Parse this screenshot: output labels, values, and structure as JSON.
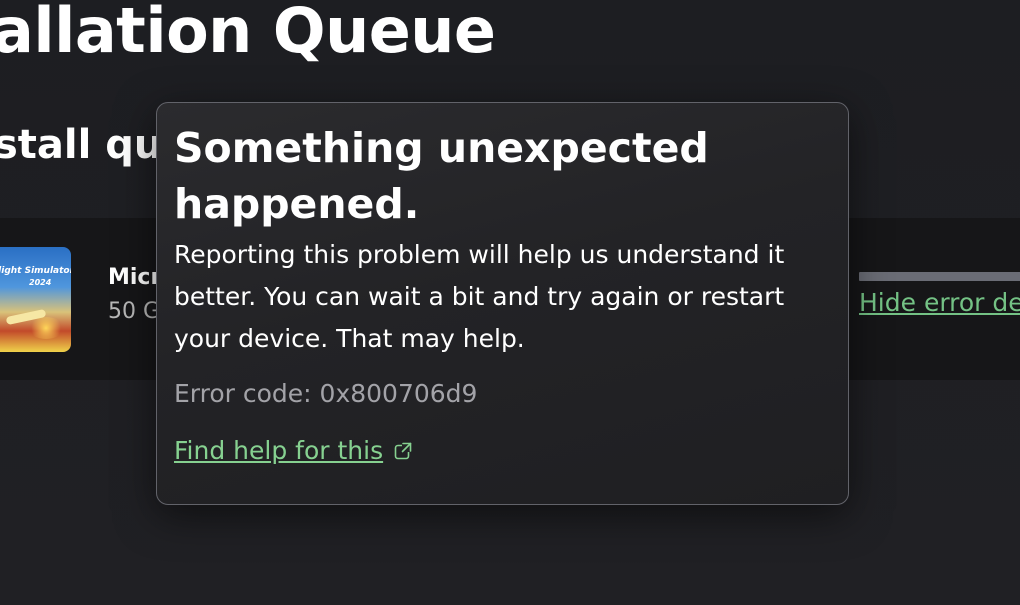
{
  "page": {
    "title": "allation Queue",
    "section_title": "stall que"
  },
  "queue_item": {
    "thumbnail_line1": "Flight Simulator",
    "thumbnail_line2": "2024",
    "name": "Micr",
    "size": "50 G",
    "hide_error_link": "Hide error de"
  },
  "dialog": {
    "title": "Something unexpected happened.",
    "body": "Reporting this problem will help us understand it better. You can wait a bit and try again or restart your device. That may help.",
    "error_code": "Error code: 0x800706d9",
    "help_link": "Find help for this",
    "help_link_icon": "external-link-icon"
  },
  "colors": {
    "background": "#202024",
    "row_background": "#161618",
    "link": "#86d190",
    "muted_text": "#a3a3a8",
    "progress_track": "#6a6c75"
  }
}
